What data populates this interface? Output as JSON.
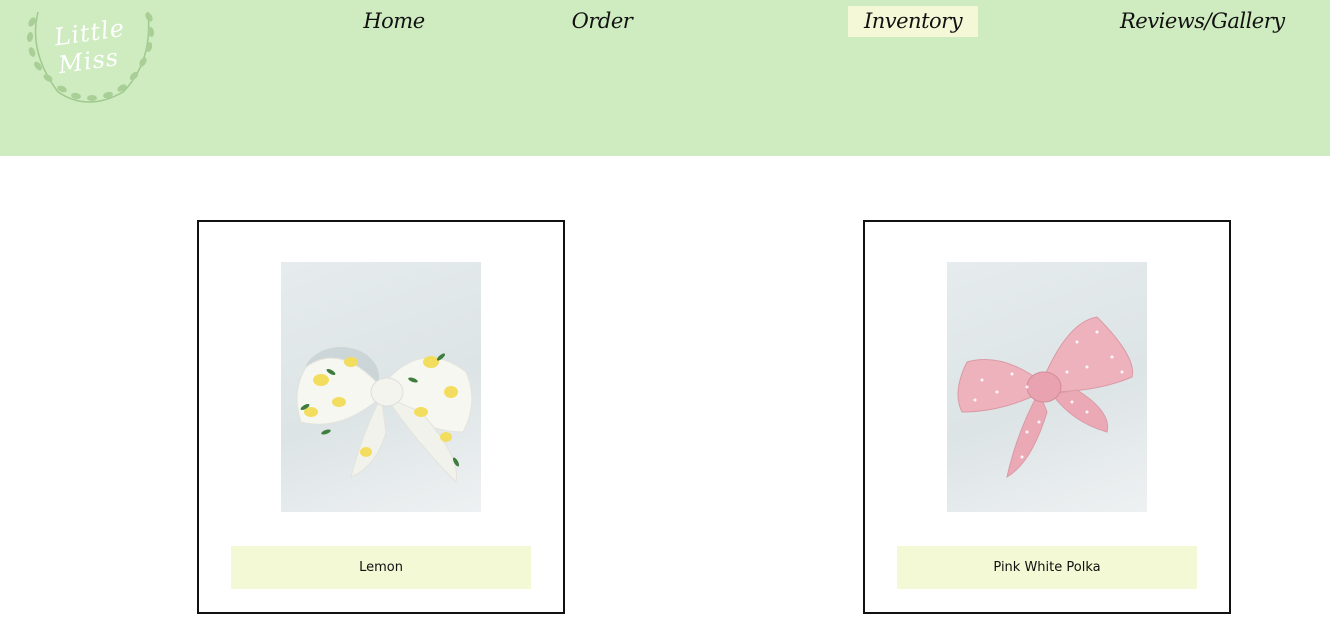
{
  "brand": {
    "logo_text": "Little Miss"
  },
  "nav": {
    "items": [
      {
        "label": "Home"
      },
      {
        "label": "Order"
      },
      {
        "label": "Inventory",
        "active": true
      },
      {
        "label": "Reviews/Gallery"
      }
    ]
  },
  "products": [
    {
      "name": "Lemon",
      "image": "lemon-print-bow"
    },
    {
      "name": "Pink White Polka",
      "image": "pink-polka-bow"
    }
  ],
  "colors": {
    "header_bg": "#cfebc0",
    "active_nav_bg": "#f4f8d6",
    "label_bg": "#f3f8d5",
    "card_border": "#111111"
  }
}
